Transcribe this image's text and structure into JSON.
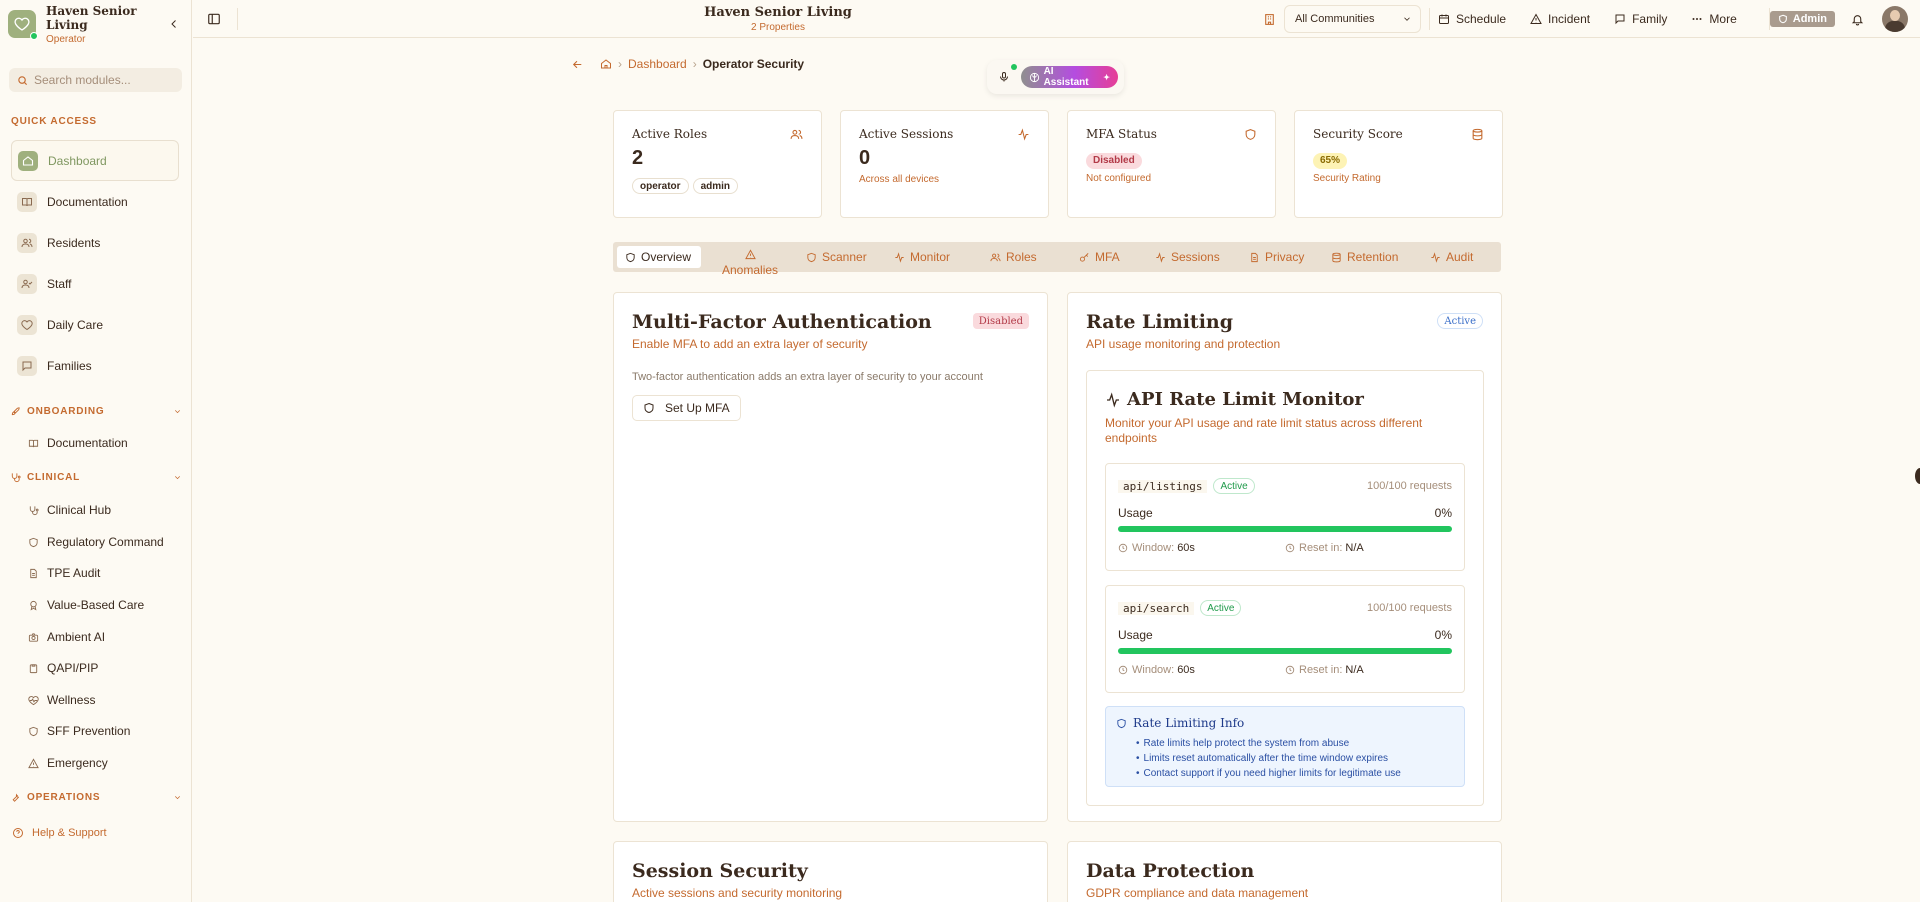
{
  "brand": {
    "name": "Haven Senior Living",
    "role": "Operator"
  },
  "search": {
    "placeholder": "Search modules..."
  },
  "quick_access": {
    "label": "QUICK ACCESS",
    "items": [
      {
        "label": "Dashboard",
        "icon": "home-icon"
      },
      {
        "label": "Documentation",
        "icon": "book-icon"
      },
      {
        "label": "Residents",
        "icon": "users-icon"
      },
      {
        "label": "Staff",
        "icon": "user-check-icon"
      },
      {
        "label": "Daily Care",
        "icon": "heart-icon"
      },
      {
        "label": "Families",
        "icon": "message-icon"
      }
    ]
  },
  "onboarding": {
    "label": "ONBOARDING",
    "items": [
      {
        "label": "Documentation"
      }
    ]
  },
  "clinical": {
    "label": "CLINICAL",
    "items": [
      {
        "label": "Clinical Hub"
      },
      {
        "label": "Regulatory Command"
      },
      {
        "label": "TPE Audit"
      },
      {
        "label": "Value-Based Care"
      },
      {
        "label": "Ambient AI"
      },
      {
        "label": "QAPI/PIP"
      },
      {
        "label": "Wellness"
      },
      {
        "label": "SFF Prevention"
      },
      {
        "label": "Emergency"
      }
    ]
  },
  "operations": {
    "label": "OPERATIONS"
  },
  "help": {
    "label": "Help & Support"
  },
  "topbar": {
    "title": "Haven Senior Living",
    "subtitle": "2 Properties",
    "community": "All Communities",
    "buttons": {
      "schedule": "Schedule",
      "incident": "Incident",
      "family": "Family",
      "more": "More"
    },
    "admin": "Admin"
  },
  "breadcrumb": {
    "dashboard": "Dashboard",
    "current": "Operator Security"
  },
  "ai": {
    "label": "AI Assistant"
  },
  "stats": {
    "roles": {
      "title": "Active Roles",
      "value": "2",
      "tags": [
        "operator",
        "admin"
      ]
    },
    "sessions": {
      "title": "Active Sessions",
      "value": "0",
      "note": "Across all devices"
    },
    "mfa": {
      "title": "MFA Status",
      "badge": "Disabled",
      "note": "Not configured"
    },
    "score": {
      "title": "Security Score",
      "badge": "65%",
      "note": "Security Rating",
      "value_percent": 65
    }
  },
  "tabs": [
    {
      "label": "Overview"
    },
    {
      "label": "Anomalies"
    },
    {
      "label": "Scanner"
    },
    {
      "label": "Monitor"
    },
    {
      "label": "Roles"
    },
    {
      "label": "MFA"
    },
    {
      "label": "Sessions"
    },
    {
      "label": "Privacy"
    },
    {
      "label": "Retention"
    },
    {
      "label": "Audit"
    }
  ],
  "mfa_panel": {
    "title": "Multi-Factor Authentication",
    "status": "Disabled",
    "subtitle": "Enable MFA to add an extra layer of security",
    "description": "Two-factor authentication adds an extra layer of security to your account",
    "button": "Set Up MFA"
  },
  "rate_panel": {
    "title": "Rate Limiting",
    "status": "Active",
    "subtitle": "API usage monitoring and protection",
    "monitor": {
      "title": "API Rate Limit Monitor",
      "subtitle": "Monitor your API usage and rate limit status across different endpoints",
      "endpoints": [
        {
          "path": "api/listings",
          "status": "Active",
          "requests": "100/100 requests",
          "usage_label": "Usage",
          "usage": "0%",
          "usage_percent": 0,
          "window_label": "Window:",
          "window": "60s",
          "reset_label": "Reset in:",
          "reset": "N/A"
        },
        {
          "path": "api/search",
          "status": "Active",
          "requests": "100/100 requests",
          "usage_label": "Usage",
          "usage": "0%",
          "usage_percent": 0,
          "window_label": "Window:",
          "window": "60s",
          "reset_label": "Reset in:",
          "reset": "N/A"
        }
      ],
      "info": {
        "title": "Rate Limiting Info",
        "items": [
          "Rate limits help protect the system from abuse",
          "Limits reset automatically after the time window expires",
          "Contact support if you need higher limits for legitimate use"
        ]
      }
    }
  },
  "session_panel": {
    "title": "Session Security",
    "subtitle": "Active sessions and security monitoring"
  },
  "data_panel": {
    "title": "Data Protection",
    "subtitle": "GDPR compliance and data management"
  },
  "colors": {
    "accent": "#c46a2f",
    "sage": "#9fb07e",
    "success": "#22c55e",
    "danger": "#b23a48"
  }
}
